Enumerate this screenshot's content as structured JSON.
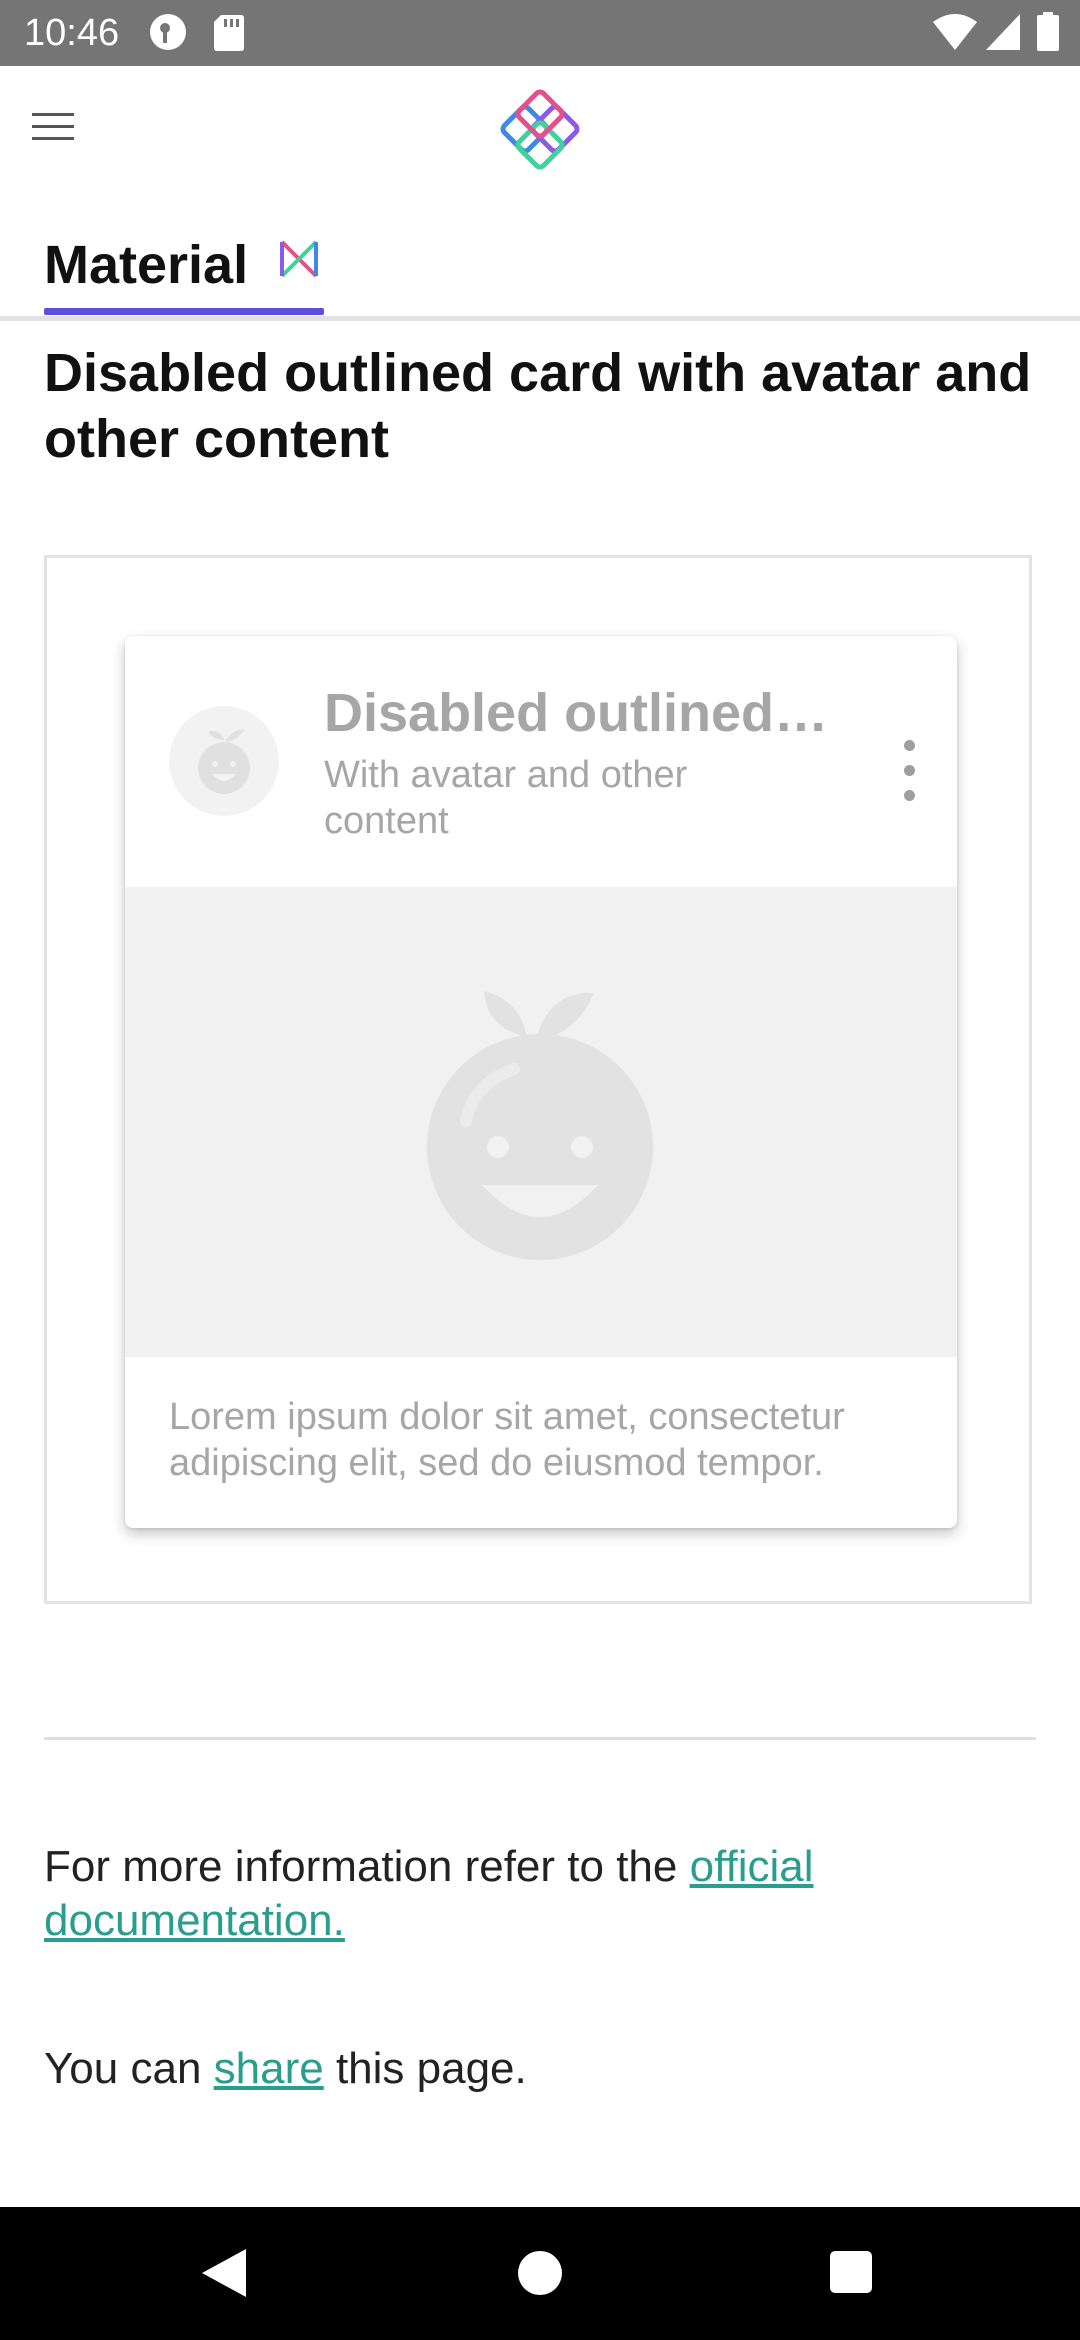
{
  "status_bar": {
    "time": "10:46",
    "icons": [
      "vpn-key-icon",
      "sd-card-icon",
      "wifi-icon",
      "cell-signal-icon",
      "battery-icon"
    ]
  },
  "app_bar": {
    "menu_icon": "hamburger-menu-icon",
    "logo_icon": "app-logo-icon"
  },
  "tabs": [
    {
      "label": "Material",
      "icon": "material-design-icon",
      "selected": true
    }
  ],
  "page": {
    "title": "Disabled outlined card with avatar and other content"
  },
  "card": {
    "title": "Disabled outlined…",
    "subtitle": "With avatar and other content",
    "body": "Lorem ipsum dolor sit amet, consectetur adipiscing elit, sed do eiusmod tempor.",
    "avatar_icon": "smiling-fruit-icon",
    "menu_icon": "more-vert-icon",
    "disabled": true
  },
  "info": {
    "prefix": "For more information refer to the ",
    "link_text": "official documentation."
  },
  "share": {
    "prefix": "You can ",
    "link_text": "share",
    "suffix": " this page."
  },
  "nav_bar": {
    "icons": [
      "back-icon",
      "home-icon",
      "recents-icon"
    ]
  },
  "colors": {
    "accent": "#5b4fdc",
    "link": "#2a9d8f",
    "status_bar": "#757575",
    "disabled_text": "#a6a6a6"
  }
}
